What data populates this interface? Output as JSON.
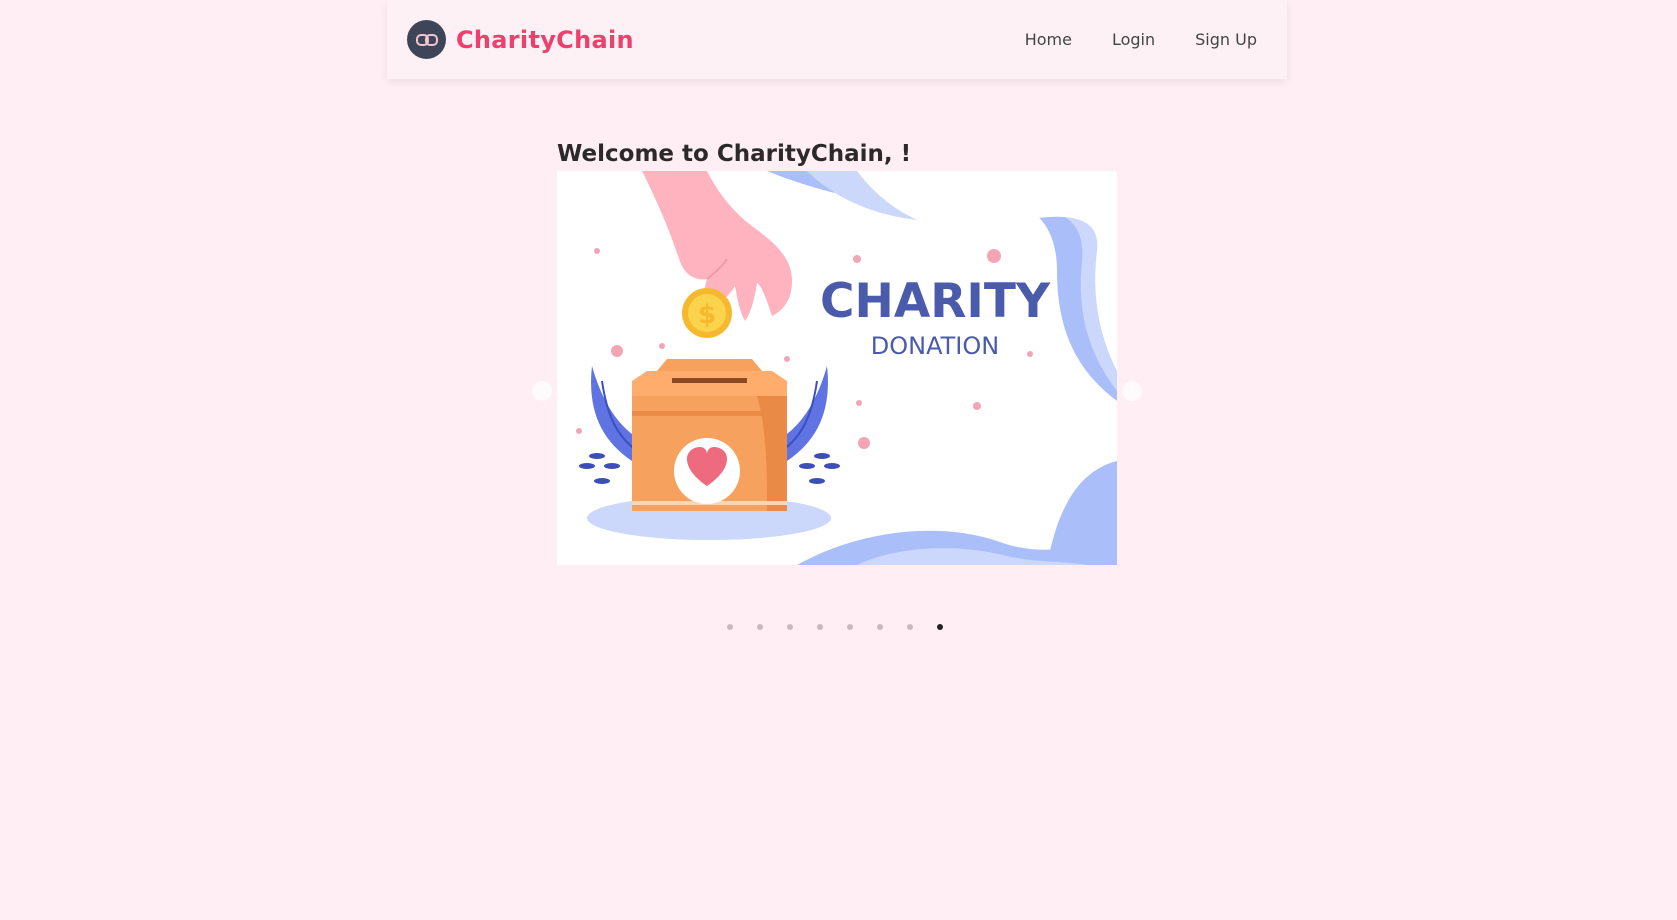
{
  "header": {
    "brand_name": "CharityChain",
    "brand_icon": "link-icon",
    "nav": [
      {
        "label": "Home"
      },
      {
        "label": "Login"
      },
      {
        "label": "Sign Up"
      }
    ]
  },
  "main": {
    "welcome": "Welcome to CharityChain, !",
    "carousel": {
      "slide_title": "CHARITY",
      "slide_subtitle": "DONATION",
      "prev_icon": "chevron-left-icon",
      "next_icon": "chevron-right-icon",
      "total_slides": 8,
      "active_slide": 8
    }
  },
  "colors": {
    "background": "#ffeef3",
    "brand": "#ee3f6d",
    "slide_text": "#4a5bab"
  }
}
